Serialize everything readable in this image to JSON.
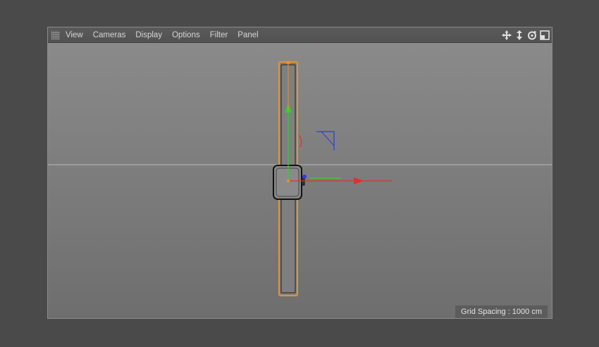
{
  "menu": {
    "view": "View",
    "cameras": "Cameras",
    "display": "Display",
    "options": "Options",
    "filter": "Filter",
    "panel": "Panel"
  },
  "nav_icons": [
    "move-view-icon",
    "dolly-view-icon",
    "rotate-view-icon",
    "maximize-view-icon"
  ],
  "viewport": {
    "grid_spacing_label": "Grid Spacing : 1000 cm"
  },
  "colors": {
    "selection_outline": "#e8932a",
    "axis_x": "#e03030",
    "axis_y": "#2fd12f",
    "axis_z": "#2a3ee0",
    "background_top": "#8a8a8a",
    "background_bottom": "#6e6e6e"
  }
}
